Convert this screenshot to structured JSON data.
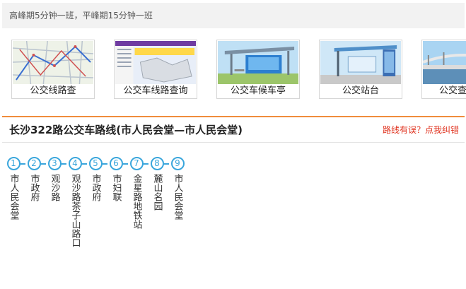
{
  "notice": {
    "text": "高峰期5分钟一班，平峰期15分钟一班"
  },
  "thumbnails": [
    {
      "label": "公交线路查",
      "icon": "map-thumbnail"
    },
    {
      "label": "公交车线路查询",
      "icon": "software-thumbnail"
    },
    {
      "label": "公交车候车亭",
      "icon": "bus-shelter-thumbnail"
    },
    {
      "label": "公交站台",
      "icon": "bus-stop-thumbnail"
    },
    {
      "label": "公交查",
      "icon": "bridge-thumbnail"
    }
  ],
  "route": {
    "title": "长沙322路公交车路线(市人民会堂—市人民会堂)",
    "report_link": "路线有误？点我纠错"
  },
  "stops": [
    {
      "num": "1",
      "name": "市人民会堂"
    },
    {
      "num": "2",
      "name": "市政府"
    },
    {
      "num": "3",
      "name": "观沙路"
    },
    {
      "num": "4",
      "name": "观沙路茶子山路口"
    },
    {
      "num": "5",
      "name": "市政府"
    },
    {
      "num": "6",
      "name": "市妇联"
    },
    {
      "num": "7",
      "name": "金星路地铁站"
    },
    {
      "num": "8",
      "name": "麓山名园"
    },
    {
      "num": "9",
      "name": "市人民会堂"
    }
  ],
  "colors": {
    "accent_blue": "#3aa6dc",
    "header_orange": "#f08c3c",
    "link_red": "#e0311d"
  }
}
